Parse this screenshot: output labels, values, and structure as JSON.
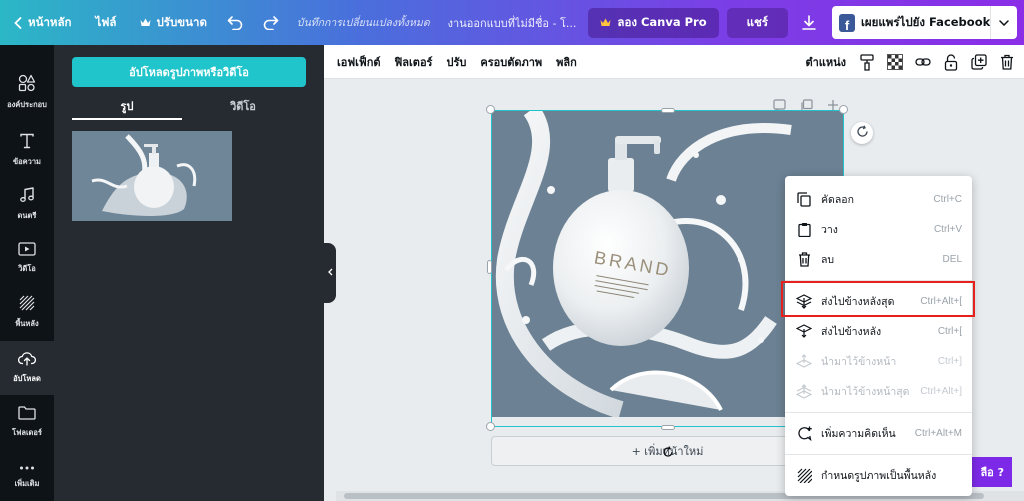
{
  "topbar": {
    "home_label": "หน้าหลัก",
    "file_label": "ไฟล์",
    "resize_label": "ปรับขนาด",
    "save_status": "บันทึกการเปลี่ยนแปลงทั้งหมด",
    "design_title": "งานออกแบบที่ไม่มีชื่อ - โ...",
    "try_pro_label": "ลอง Canva Pro",
    "share_label": "แชร์",
    "publish_label": "เผยแพร่ไปยัง Facebook",
    "fb_logo_letter": "f"
  },
  "rail": {
    "items": [
      {
        "label": "องค์ประกอบ",
        "icon": "elements-icon"
      },
      {
        "label": "ข้อความ",
        "icon": "text-icon"
      },
      {
        "label": "ดนตรี",
        "icon": "music-icon"
      },
      {
        "label": "วิดีโอ",
        "icon": "video-icon"
      },
      {
        "label": "พื้นหลัง",
        "icon": "background-icon"
      },
      {
        "label": "อัปโหลด",
        "icon": "upload-icon"
      },
      {
        "label": "โฟลเดอร์",
        "icon": "folder-icon"
      },
      {
        "label": "เพิ่มเติม",
        "icon": "more-icon"
      }
    ]
  },
  "panel": {
    "upload_button": "อัปโหลดรูปภาพหรือวิดีโอ",
    "tabs": [
      "รูป",
      "วิดีโอ"
    ]
  },
  "toolbar": {
    "effects": "เอฟเฟ็กต์",
    "filter": "ฟิลเตอร์",
    "adjust": "ปรับ",
    "crop": "ครอบตัดภาพ",
    "flip": "พลิก",
    "position": "ตำแหน่ง"
  },
  "canvas": {
    "brand_text": "BRAND",
    "add_page_label": "+ เพิ่มหน้าใหม่"
  },
  "context_menu": {
    "items": [
      {
        "label": "คัดลอก",
        "shortcut": "Ctrl+C",
        "icon": "copy-icon",
        "enabled": true
      },
      {
        "label": "วาง",
        "shortcut": "Ctrl+V",
        "icon": "paste-icon",
        "enabled": true
      },
      {
        "label": "ลบ",
        "shortcut": "DEL",
        "icon": "trash-icon",
        "enabled": true
      },
      {
        "label": "ส่งไปข้างหลังสุด",
        "shortcut": "Ctrl+Alt+[",
        "icon": "send-to-back-icon",
        "enabled": true
      },
      {
        "label": "ส่งไปข้างหลัง",
        "shortcut": "Ctrl+[",
        "icon": "send-backward-icon",
        "enabled": true
      },
      {
        "label": "นำมาไว้ข้างหน้า",
        "shortcut": "Ctrl+]",
        "icon": "bring-forward-icon",
        "enabled": false
      },
      {
        "label": "นำมาไว้ข้างหน้าสุด",
        "shortcut": "Ctrl+Alt+]",
        "icon": "bring-to-front-icon",
        "enabled": false
      },
      {
        "label": "เพิ่มความคิดเห็น",
        "shortcut": "Ctrl+Alt+M",
        "icon": "comment-icon",
        "enabled": true
      },
      {
        "label": "กำหนดรูปภาพเป็นพื้นหลัง",
        "shortcut": "",
        "icon": "set-background-icon",
        "enabled": true
      }
    ]
  },
  "help_label": "ลือ ?",
  "colors": {
    "accent": "#20c4cb",
    "highlight": "#e8201c",
    "rail_bg": "#0e1318",
    "panel_bg": "#252b31",
    "pro_purple": "#7d2ae8"
  }
}
